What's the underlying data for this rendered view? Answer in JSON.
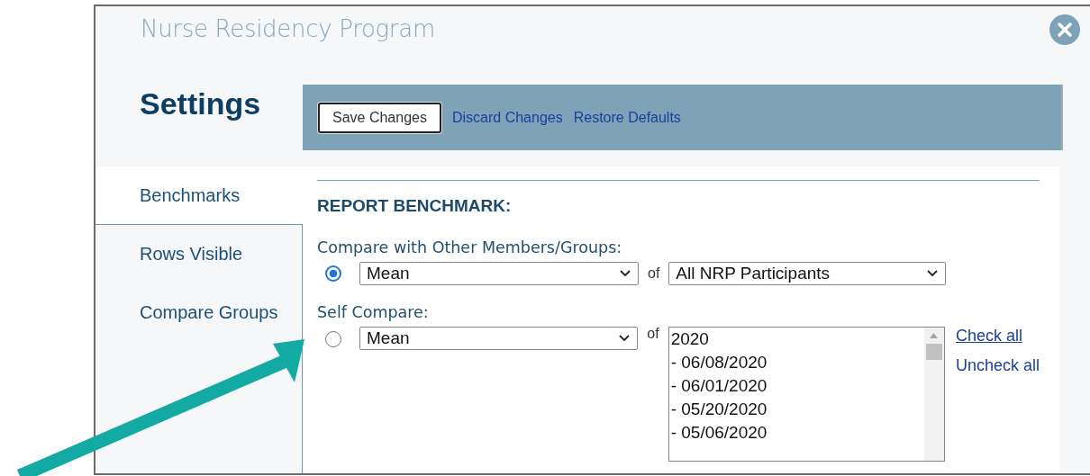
{
  "window": {
    "title": "Nurse Residency Program"
  },
  "page_title": "Settings",
  "toolbar": {
    "buttons": [
      {
        "kind": "button",
        "label": "Save Changes"
      },
      {
        "kind": "link",
        "label": "Discard Changes"
      },
      {
        "kind": "link",
        "label": "Restore Defaults"
      }
    ]
  },
  "sidebar": {
    "items": [
      {
        "label": "Benchmarks",
        "selected": true
      },
      {
        "label": "Rows Visible",
        "selected": false
      },
      {
        "label": "Compare Groups",
        "selected": false
      }
    ]
  },
  "section": {
    "heading": "REPORT BENCHMARK:",
    "groups": [
      {
        "label": "Compare with Other Members/Groups:",
        "selected": true,
        "statistic": "Mean",
        "of": "of",
        "target": {
          "kind": "dropdown",
          "value": "All NRP Participants"
        }
      },
      {
        "label": "Self Compare:",
        "selected": false,
        "statistic": "Mean",
        "of": "of",
        "target": {
          "kind": "listbox",
          "options": [
            "2020",
            "- 06/08/2020",
            "- 06/01/2020",
            "- 05/20/2020",
            "- 05/06/2020"
          ],
          "links": [
            {
              "label": "Check all",
              "underlined": true
            },
            {
              "label": "Uncheck all",
              "underlined": false
            }
          ]
        }
      }
    ]
  }
}
